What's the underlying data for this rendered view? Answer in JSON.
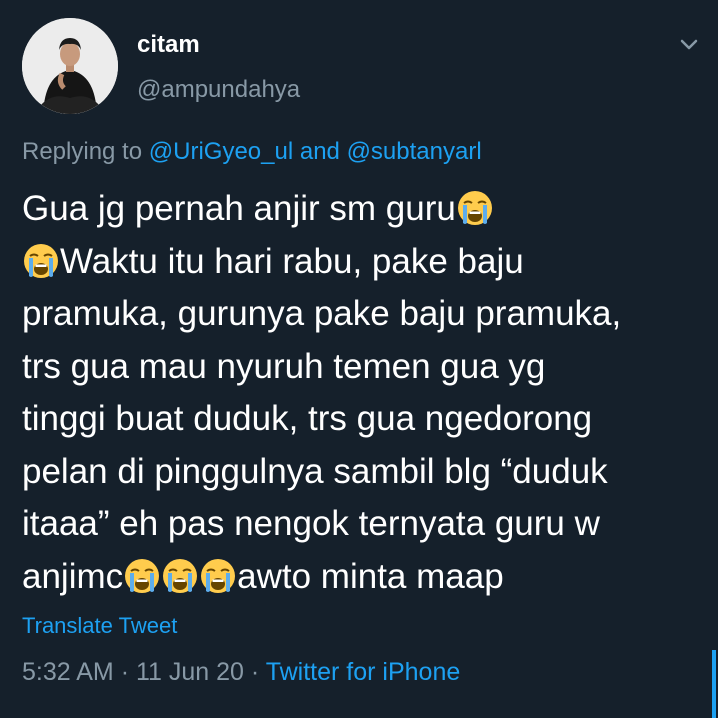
{
  "user": {
    "display_name": "citam",
    "handle": "@ampundahya"
  },
  "reply": {
    "prefix": "Replying to",
    "user1": "@UriGyeo_ul",
    "joiner": "and",
    "user2": "@subtanyarl"
  },
  "tweet": {
    "line1": "Gua jg pernah anjir sm guru",
    "line2": "Waktu itu hari rabu, pake baju",
    "line3": "pramuka, gurunya pake baju pramuka,",
    "line4": "trs gua mau nyuruh temen gua yg",
    "line5": "tinggi buat duduk, trs gua ngedorong",
    "line6": "pelan di pinggulnya sambil blg “duduk",
    "line7": "itaaa” eh pas nengok ternyata guru w",
    "line8_a": "anjimc",
    "line8_b": "awto minta maap",
    "emoji_icon": "loudly-crying-face-icon"
  },
  "translate_label": "Translate Tweet",
  "meta": {
    "time": "5:32 AM",
    "sep1": "·",
    "date": "11 Jun 20",
    "sep2": "·",
    "source": "Twitter for iPhone"
  },
  "colors": {
    "background": "#15202b",
    "accent": "#1da1f2",
    "secondary_text": "#8899a6",
    "primary_text": "#ffffff"
  }
}
